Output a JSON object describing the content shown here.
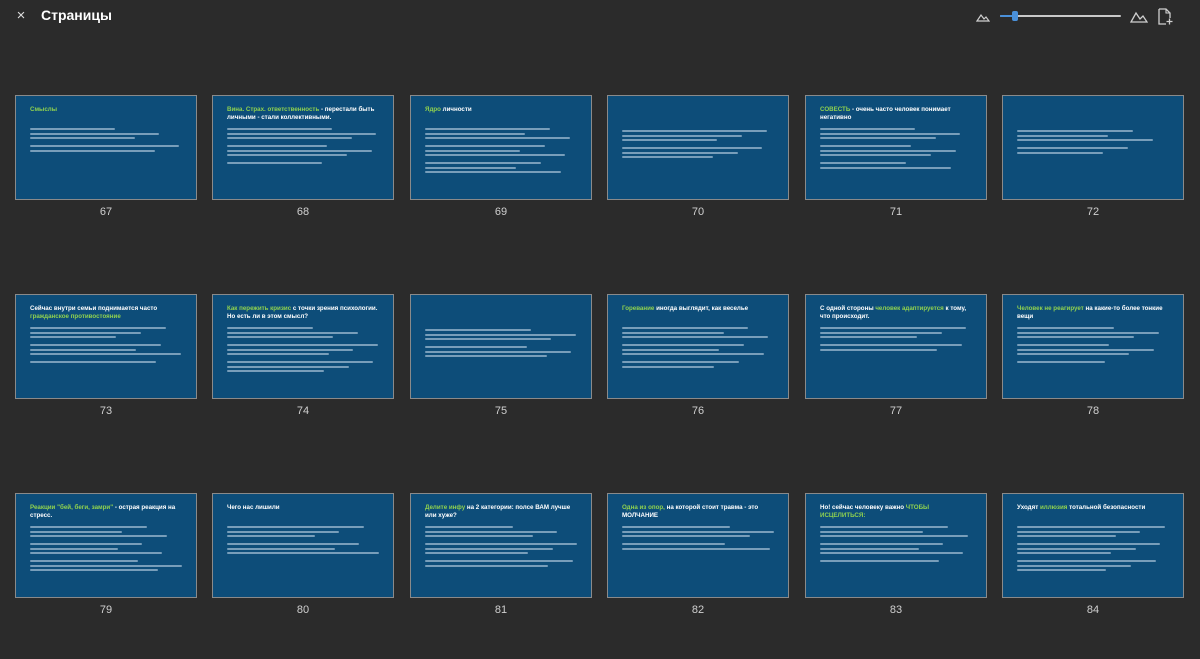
{
  "header": {
    "close_glyph": "×",
    "title": "Страницы",
    "zoom_small_icon": "mountain-small-icon",
    "zoom_large_icon": "mountain-large-icon",
    "add_page_icon": "add-page-icon",
    "zoom_level": 0.12
  },
  "colors": {
    "background": "#2b2b2b",
    "slide_background": "#0d4d79",
    "accent_green": "#8fd14f",
    "slider_blue": "#4a90d9"
  },
  "slides": [
    {
      "number": "67",
      "title_plain": "",
      "title_accent": "Смыслы",
      "title_rest": ""
    },
    {
      "number": "68",
      "title_plain": "",
      "title_accent": "Вина. Страх. ответственность",
      "title_rest": " - перестали быть личными - стали коллективными."
    },
    {
      "number": "69",
      "title_plain": "",
      "title_accent": "Ядро",
      "title_rest": " личности"
    },
    {
      "number": "70",
      "title_plain": "",
      "title_accent": "",
      "title_rest": ""
    },
    {
      "number": "71",
      "title_plain": "",
      "title_accent": "СОВЕСТЬ",
      "title_rest": " - очень часто человек понимает негативно"
    },
    {
      "number": "72",
      "title_plain": "",
      "title_accent": "",
      "title_rest": ""
    },
    {
      "number": "73",
      "title_plain": "Сейчас внутри семьи поднимается часто ",
      "title_accent": "гражданское противостояние",
      "title_rest": ""
    },
    {
      "number": "74",
      "title_plain": "",
      "title_accent": "Как пережить кризис",
      "title_rest": " с точки зрения психологии. Но есть ли в этом смысл?"
    },
    {
      "number": "75",
      "title_plain": "",
      "title_accent": "",
      "title_rest": ""
    },
    {
      "number": "76",
      "title_plain": "",
      "title_accent": "Горевание",
      "title_rest": " иногда выглядит, как веселье"
    },
    {
      "number": "77",
      "title_plain": "С одной стороны ",
      "title_accent": "человек адаптируется",
      "title_rest": " к тому, что происходит."
    },
    {
      "number": "78",
      "title_plain": "",
      "title_accent": "Человек не реагирует",
      "title_rest": " на какие-то более тонкие вещи"
    },
    {
      "number": "79",
      "title_plain": "",
      "title_accent": "Реакции \"бей, беги, замри\"",
      "title_rest": " - острая реакция на стресс."
    },
    {
      "number": "80",
      "title_plain": "Чего нас лишили",
      "title_accent": "",
      "title_rest": ""
    },
    {
      "number": "81",
      "title_plain": "",
      "title_accent": "Делите инфу",
      "title_rest": " на 2 категории: полсе ВАМ лучше или хуже?"
    },
    {
      "number": "82",
      "title_plain": "",
      "title_accent": "Одна из опор,",
      "title_rest": " на которой стоит травма - это МОЛЧАНИЕ"
    },
    {
      "number": "83",
      "title_plain": "Но! сейчас человеку важно ",
      "title_accent": "ЧТОБЫ ИСЦЕЛИТЬСЯ:",
      "title_rest": ""
    },
    {
      "number": "84",
      "title_plain": "Уходят ",
      "title_accent": "иллюзия",
      "title_rest": " тотальной безопасности"
    }
  ]
}
